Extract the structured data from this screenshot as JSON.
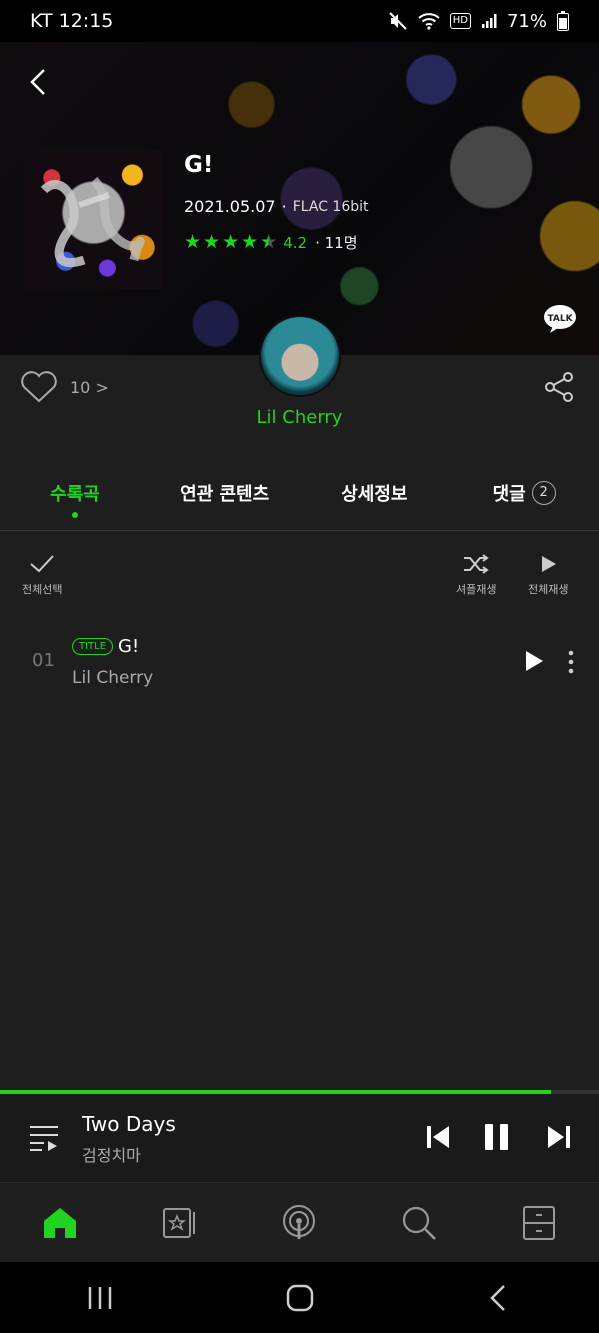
{
  "status_bar": {
    "carrier_time": "KT 12:15",
    "battery": "71%",
    "hd_label": "HD"
  },
  "album": {
    "title": "G!",
    "release_date": "2021.05.07",
    "separator": "·",
    "format": "FLAC 16bit",
    "rating": 4.2,
    "rating_text": "4.2",
    "rating_count": "· 11명",
    "talk_label": "TALK"
  },
  "actions": {
    "like_count": "10 >"
  },
  "artist": {
    "name": "Lil Cherry"
  },
  "tabs": [
    {
      "label": "수록곡",
      "active": true
    },
    {
      "label": "연관 콘텐츠",
      "active": false
    },
    {
      "label": "상세정보",
      "active": false
    },
    {
      "label": "댓글",
      "active": false,
      "count": "2"
    }
  ],
  "toolbar": {
    "select_all": "전체선택",
    "shuffle": "셔플재생",
    "play_all": "전체재생"
  },
  "tracks": [
    {
      "number": "01",
      "badge": "TITLE",
      "title": "G!",
      "artist": "Lil Cherry"
    }
  ],
  "now_playing": {
    "title": "Two Days",
    "artist": "검정치마",
    "progress": 0.92
  },
  "colors": {
    "accent": "#20d520",
    "background": "#1e1e1e"
  },
  "icons": {
    "bottom_nav": [
      "home-icon",
      "library-icon",
      "podcast-icon",
      "search-icon",
      "storage-icon"
    ],
    "system_nav": [
      "recent-apps-icon",
      "home-button-icon",
      "back-icon"
    ]
  }
}
